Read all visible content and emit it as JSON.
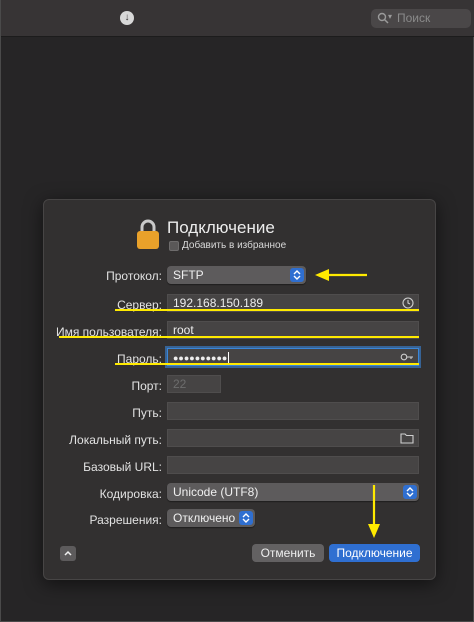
{
  "toolbar": {
    "search_placeholder": "Поиск"
  },
  "dialog": {
    "title": "Подключение",
    "add_to_favorites": "Добавить в избранное",
    "protocol": {
      "label": "Протокол:",
      "value": "SFTP"
    },
    "server": {
      "label": "Сервер:",
      "value": "192.168.150.189"
    },
    "username": {
      "label": "Имя пользователя:",
      "value": "root"
    },
    "password": {
      "label": "Пароль:",
      "value": "●●●●●●●●●●"
    },
    "port": {
      "label": "Порт:",
      "placeholder": "22"
    },
    "path": {
      "label": "Путь:",
      "value": ""
    },
    "local_path": {
      "label": "Локальный путь:",
      "value": ""
    },
    "base_url": {
      "label": "Базовый URL:",
      "value": ""
    },
    "encoding": {
      "label": "Кодировка:",
      "value": "Unicode (UTF8)"
    },
    "permissions": {
      "label": "Разрешения:",
      "value": "Отключено"
    },
    "cancel_label": "Отменить",
    "connect_label": "Подключение"
  },
  "colors": {
    "accent": "#2f6fd1",
    "annotation": "#ffea00",
    "lock": "#e9a12a"
  }
}
